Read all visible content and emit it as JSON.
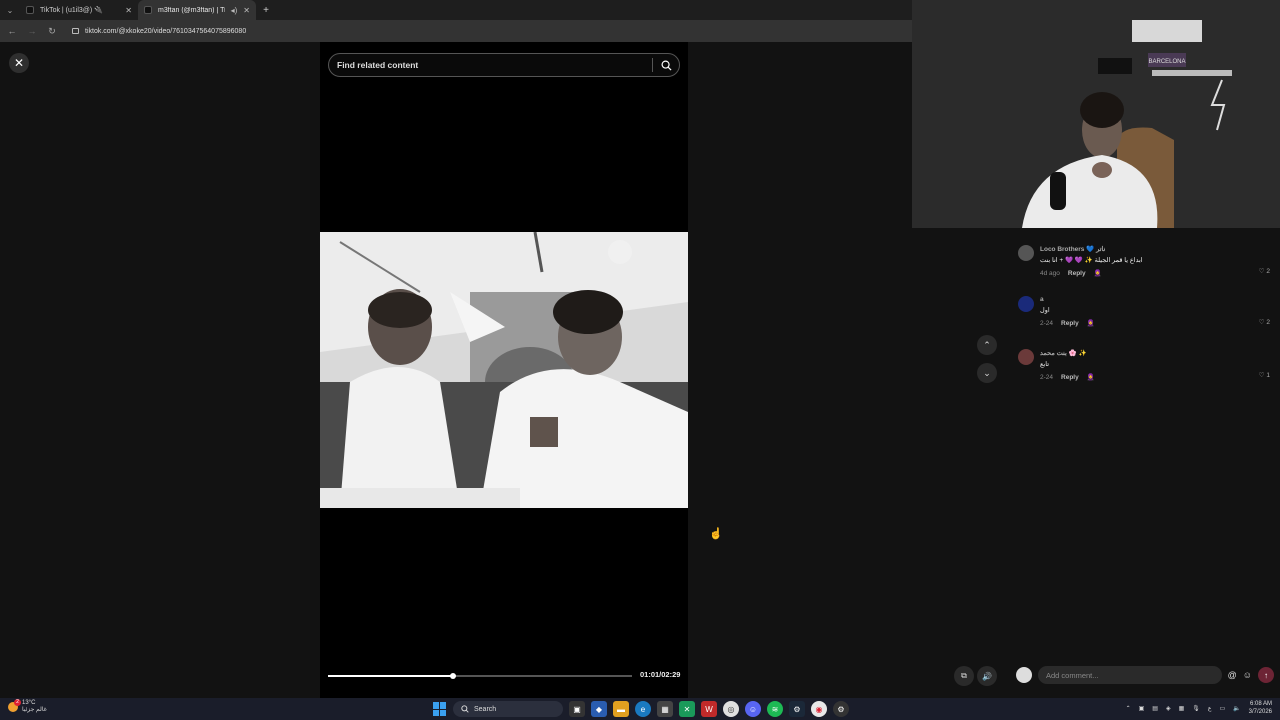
{
  "browser": {
    "tabs": [
      {
        "title": "TikTok | (u1il3@) 🔌",
        "active": false
      },
      {
        "title": "m3ftan (@m3ftan) | TikTok",
        "active": true
      }
    ],
    "new_tab_label": "+",
    "url": "tiktok.com/@xkoke20/video/7610347564075896080"
  },
  "player": {
    "close_label": "✕",
    "search_placeholder": "Find related content",
    "time": "01:01/02:29",
    "progress": 0.41
  },
  "comments": [
    {
      "user": "Loco Brothers 💙 ناتر",
      "text": "ابداع يا قمر الجيلة ✨ 💜 💜 + انا بنت",
      "date": "4d ago",
      "reply": "Reply",
      "likes": "2",
      "avatar_color": "#555"
    },
    {
      "user": "a",
      "text": "اول",
      "date": "2-24",
      "reply": "Reply",
      "likes": "2",
      "avatar_color": "#1a2a7a"
    },
    {
      "user": "بنت محمد 🌸 ✨",
      "text": "تابع",
      "date": "2-24",
      "reply": "Reply",
      "likes": "1",
      "avatar_color": "#6b3a3a"
    }
  ],
  "comment_input": {
    "placeholder": "Add comment...",
    "at": "@",
    "emoji": "☺",
    "send": "↑"
  },
  "scroll": {
    "up": "⌃",
    "down": "⌄"
  },
  "taskbar": {
    "temp": "13°C",
    "weather_text": "غالم جزئيا",
    "weather_badge": "2",
    "search_label": "Search",
    "lang": "ع",
    "time": "6:08 AM",
    "date": "3/7/2026"
  },
  "webcam": {
    "sign_text": "BARCELONA"
  }
}
